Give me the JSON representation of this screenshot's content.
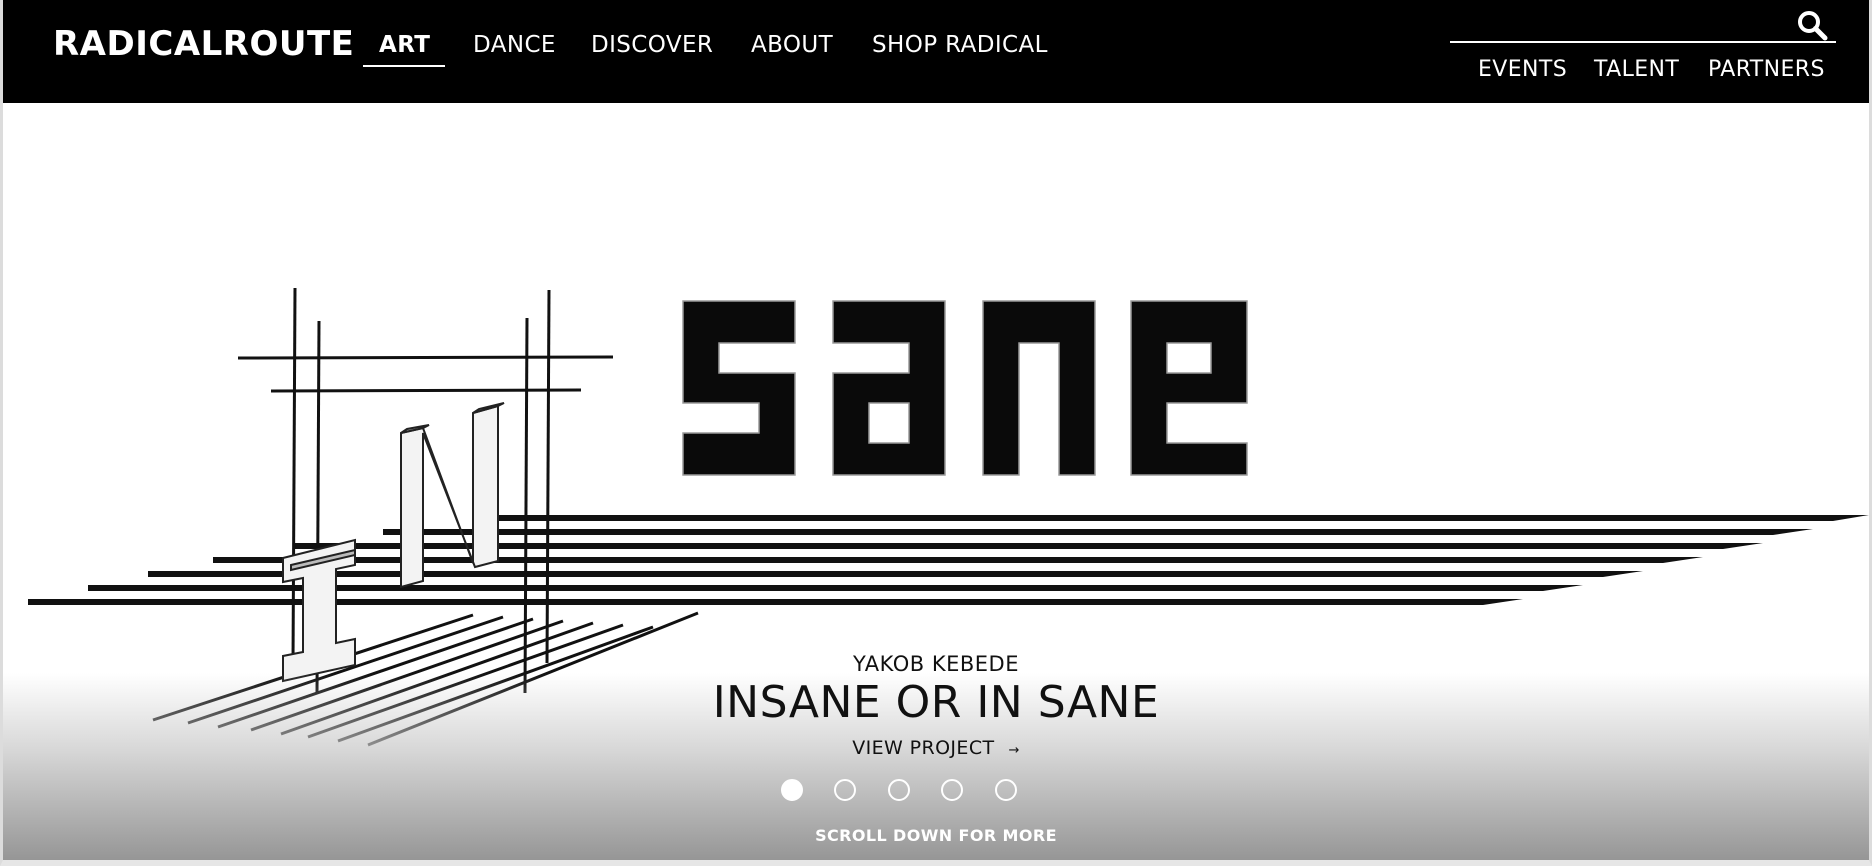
{
  "brand": {
    "logo": "RADICALROUTE"
  },
  "nav": {
    "items": [
      "ART",
      "DANCE",
      "DISCOVER",
      "ABOUT",
      "SHOP RADICAL"
    ],
    "active": "ART"
  },
  "subnav": {
    "items": [
      "EVENTS",
      "TALENT",
      "PARTNERS"
    ]
  },
  "hero": {
    "artist": "YAKOB KEBEDE",
    "title": "INSANE OR IN SANE",
    "cta": "VIEW PROJECT",
    "cta_arrow": "→",
    "slides_total": 5,
    "active_slide": 1,
    "scroll_hint": "SCROLL DOWN FOR MORE"
  },
  "icons": {
    "search": "search-icon"
  },
  "colors": {
    "header_bg": "#000000",
    "header_text": "#ffffff"
  }
}
